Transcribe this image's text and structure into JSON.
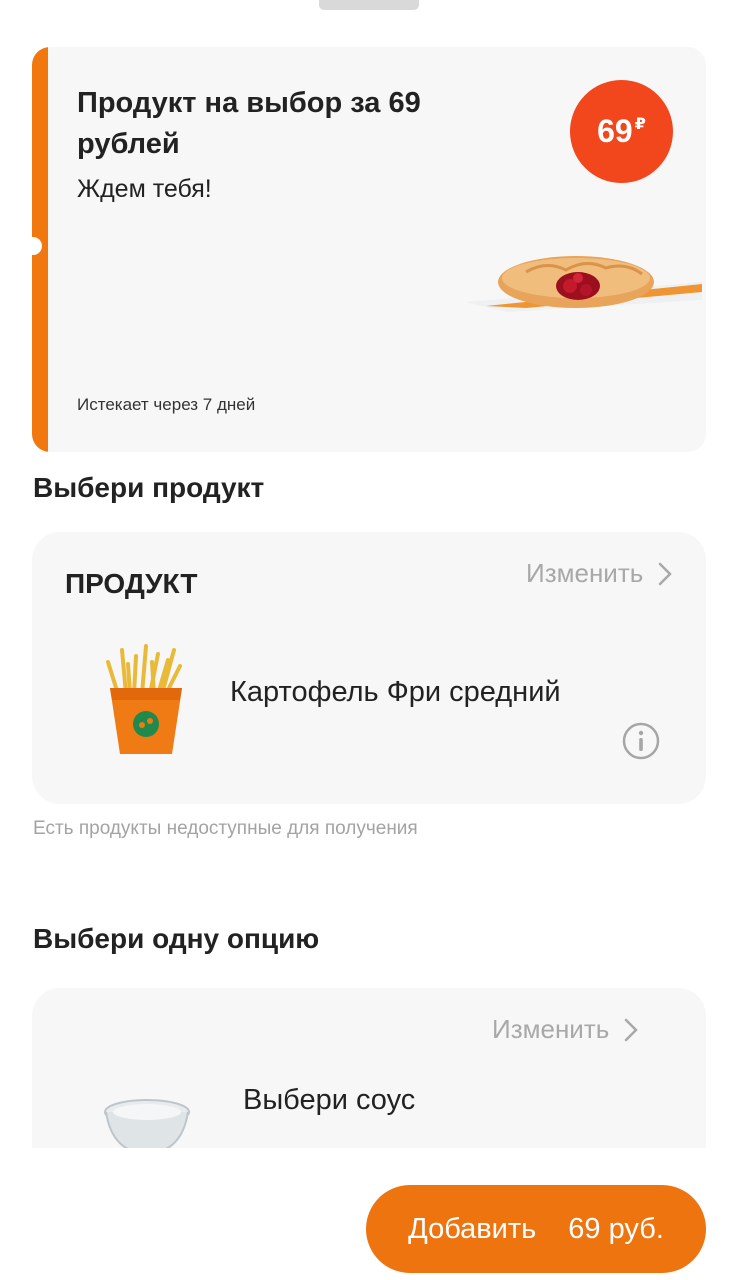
{
  "promo": {
    "title": "Продукт на выбор за 69 рублей",
    "subtitle": "Ждем тебя!",
    "expires": "Истекает через 7 дней",
    "price_value": "69",
    "price_currency": "₽",
    "image": "cherry-pie-image",
    "accent_color": "#f0780f",
    "badge_color": "#f2471d"
  },
  "section_product": {
    "title": "Выбери продукт",
    "card": {
      "label": "ПРОДУКТ",
      "change_label": "Изменить",
      "item_name": "Картофель Фри средний",
      "item_image": "french-fries-image",
      "info_icon": "info-icon"
    },
    "hint": "Есть продукты недоступные для получения"
  },
  "section_option": {
    "title": "Выбери одну опцию",
    "card": {
      "change_label": "Изменить",
      "item_name": "Выбери соус",
      "item_image": "sauce-bowl-image"
    }
  },
  "add_button": {
    "label": "Добавить",
    "price": "69 руб.",
    "color": "#ee7410"
  }
}
